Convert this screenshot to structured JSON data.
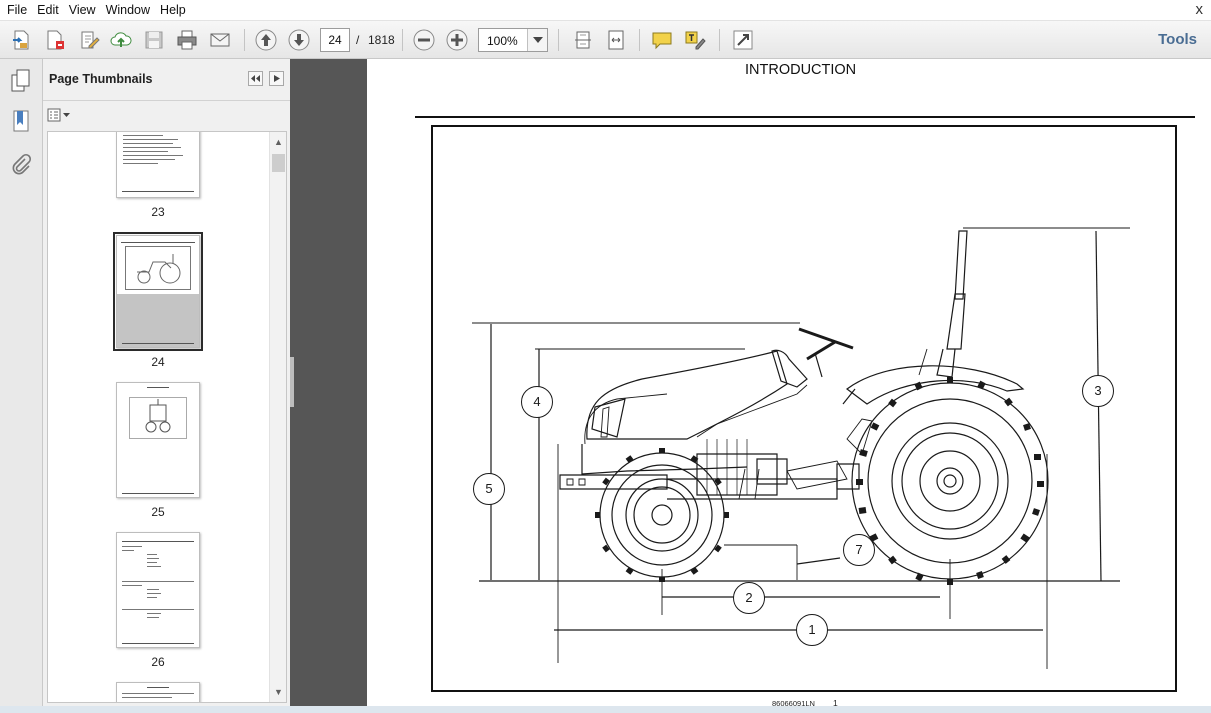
{
  "menu": {
    "items": [
      "File",
      "Edit",
      "View",
      "Window",
      "Help"
    ],
    "close_glyph": "x"
  },
  "toolbar": {
    "current_page": "24",
    "page_separator": "/",
    "total_pages": "1818",
    "zoom": "100%",
    "tools_label": "Tools",
    "icons": [
      "create-pdf-icon",
      "export-icon",
      "edit-icon",
      "upload-cloud-icon",
      "save-icon",
      "print-icon",
      "email-icon",
      "page-up-icon",
      "page-down-icon",
      "zoom-out-icon",
      "zoom-in-icon",
      "fit-page-icon",
      "fit-width-icon",
      "comment-icon",
      "highlight-text-icon",
      "expand-icon"
    ]
  },
  "sidebar": {
    "icons": [
      "pages-icon",
      "bookmarks-icon",
      "attachments-icon"
    ]
  },
  "thumbnails_panel": {
    "title": "Page Thumbnails",
    "thumbnails": [
      {
        "page": "23",
        "selected": false
      },
      {
        "page": "24",
        "selected": true
      },
      {
        "page": "25",
        "selected": false
      },
      {
        "page": "26",
        "selected": false
      }
    ]
  },
  "document": {
    "header": "INTRODUCTION",
    "callouts": [
      "1",
      "2",
      "3",
      "4",
      "5",
      "7"
    ],
    "footer_code": "86066091LN",
    "footer_page": "1"
  }
}
